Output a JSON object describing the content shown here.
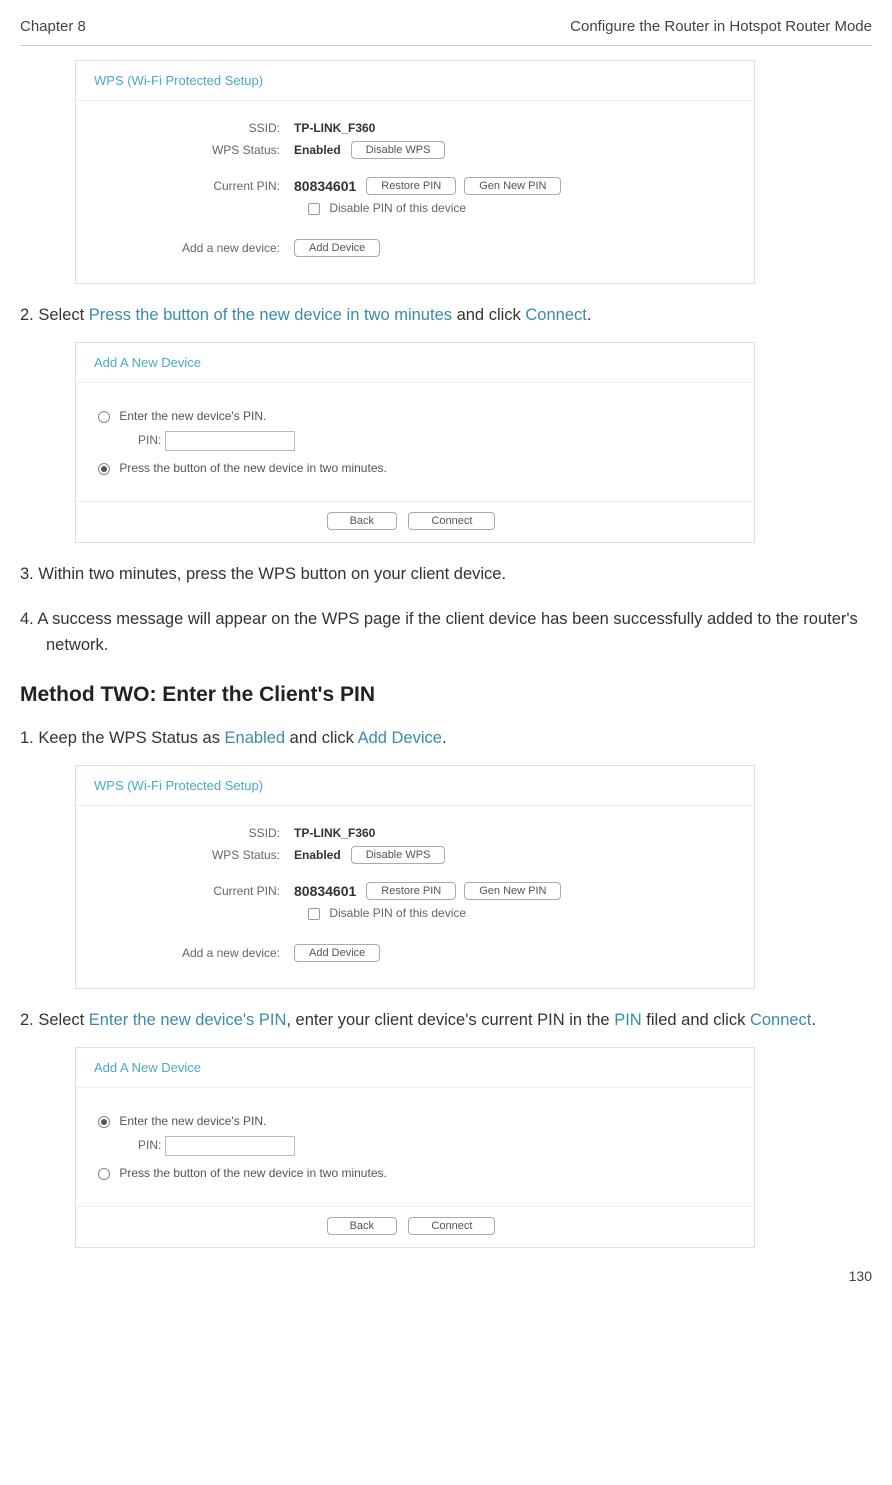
{
  "header": {
    "chapter": "Chapter 8",
    "title": "Configure the Router in Hotspot Router Mode"
  },
  "wps_panel": {
    "title": "WPS (Wi-Fi Protected Setup)",
    "ssid_label": "SSID:",
    "ssid_value": "TP-LINK_F360",
    "status_label": "WPS Status:",
    "status_value": "Enabled",
    "disable_btn": "Disable WPS",
    "pin_label": "Current PIN:",
    "pin_value": "80834601",
    "restore_btn": "Restore PIN",
    "gen_btn": "Gen New PIN",
    "disable_pin_chk": "Disable PIN of this device",
    "add_label": "Add a new device:",
    "add_btn": "Add Device"
  },
  "step2": {
    "prefix": "2. Select ",
    "mid": "Press the button of the new device in two minutes",
    "after": " and click ",
    "connect": "Connect",
    "end": "."
  },
  "add_panel": {
    "title": "Add A New Device",
    "opt1": "Enter the new device's PIN.",
    "pin_lbl": "PIN:",
    "opt2": "Press the button of the new device in two minutes.",
    "back": "Back",
    "connect": "Connect"
  },
  "step3": "3. Within two minutes, press the WPS button on your client device.",
  "step4": "4. A success message will appear on the WPS page if the client device has been successfully added to the router's network.",
  "method2": {
    "heading": "Method TWO: Enter the Client's PIN",
    "step1_a": "1. Keep the WPS Status as ",
    "enabled": "Enabled",
    "step1_b": " and click ",
    "add_device": "Add Device",
    "step1_c": "."
  },
  "m2_step2": {
    "a": "2. Select ",
    "b": "Enter the new device's PIN",
    "c": ", enter your client device's current PIN in the ",
    "d": "PIN",
    "e": " filed and click ",
    "f": "Connect",
    "g": "."
  },
  "page_number": "130"
}
